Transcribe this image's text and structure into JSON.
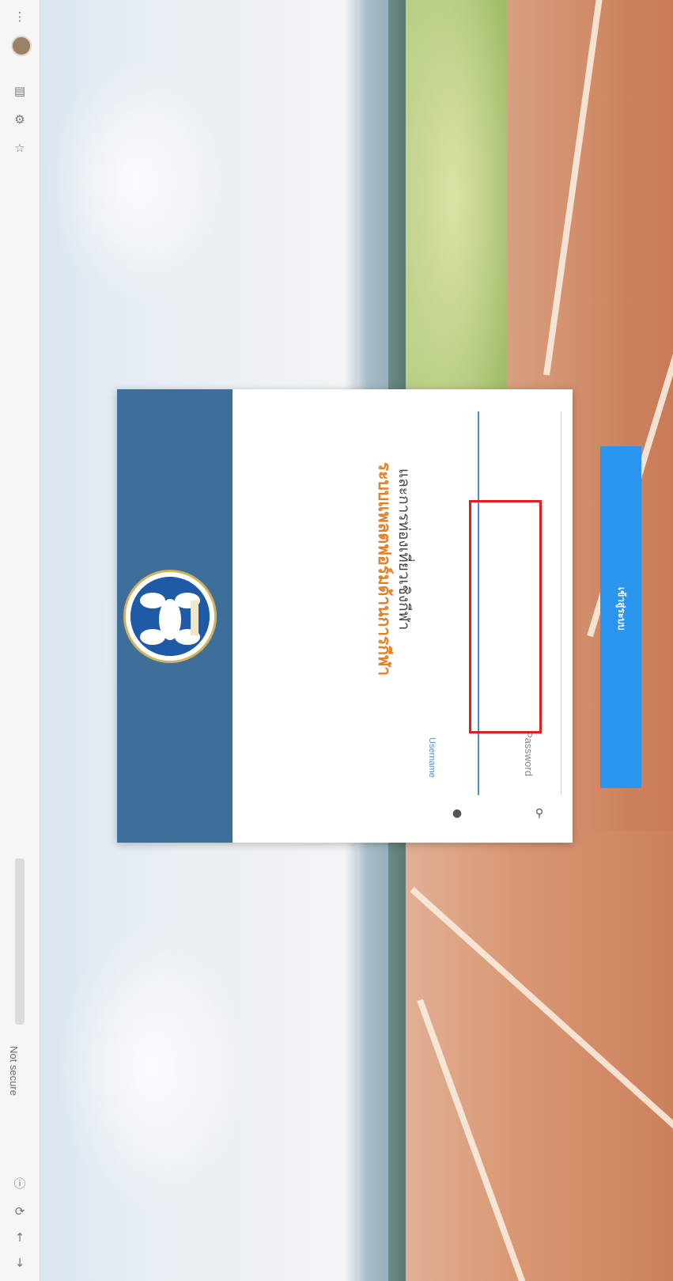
{
  "browser": {
    "security_label": "Not secure",
    "icons": [
      "back-arrow-icon",
      "forward-arrow-icon",
      "reload-icon",
      "info-icon",
      "star-icon",
      "extensions-icon",
      "sidebar-icon",
      "profile-avatar",
      "menu-dots-icon"
    ]
  },
  "login": {
    "title_line1": "ระบบแพลตฟอร์มด้านการกีฬา",
    "title_line2": "และการท่องเที่ยวเชิงกีฬา",
    "username_label": "Username",
    "password_placeholder": "Password",
    "submit_label": "เข้าสู่ระบบ"
  },
  "colors": {
    "header_bg": "#3e6e9a",
    "title_accent": "#e67e22",
    "button_bg": "#2a95ee",
    "highlight": "#e0201f"
  }
}
